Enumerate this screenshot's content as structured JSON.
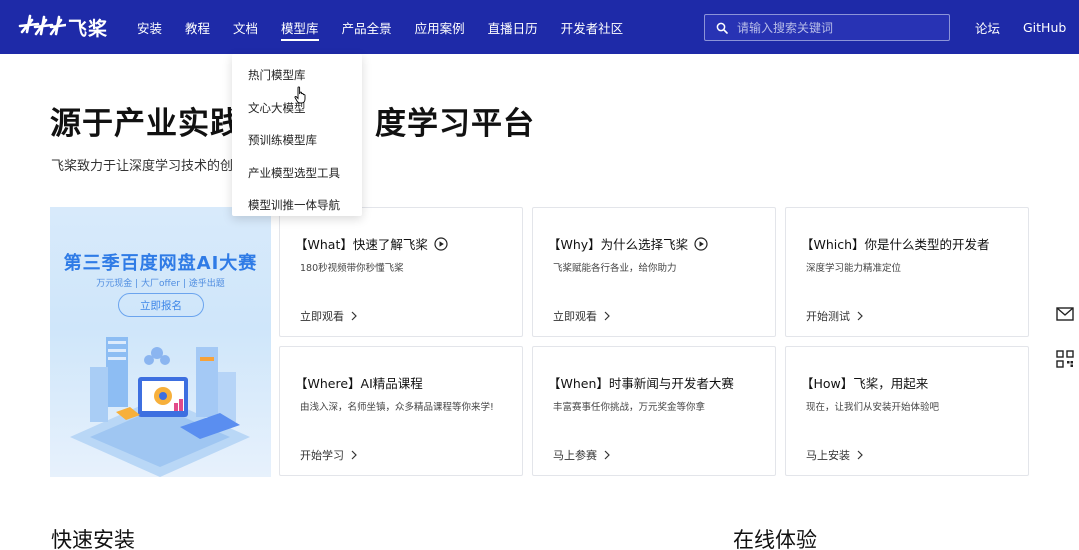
{
  "brand": {
    "name": "飞桨"
  },
  "nav": {
    "items": [
      {
        "label": "安装"
      },
      {
        "label": "教程"
      },
      {
        "label": "文档"
      },
      {
        "label": "模型库"
      },
      {
        "label": "产品全景"
      },
      {
        "label": "应用案例"
      },
      {
        "label": "直播日历"
      },
      {
        "label": "开发者社区"
      }
    ],
    "active_label": "模型库"
  },
  "search": {
    "placeholder": "请输入搜索关键词",
    "value": ""
  },
  "top_links": {
    "forum": "论坛",
    "github": "GitHub"
  },
  "dropdown": {
    "items": [
      {
        "label": "热门模型库"
      },
      {
        "label": "文心大模型"
      },
      {
        "label": "预训练模型库"
      },
      {
        "label": "产业模型选型工具"
      },
      {
        "label": "模型训推一体导航"
      }
    ]
  },
  "hero": {
    "title_left": "源于产业实践",
    "title_right": "度学习平台",
    "subtitle": "飞桨致力于让深度学习技术的创"
  },
  "banner": {
    "title": "第三季百度网盘AI大赛",
    "tags": "万元现金 | 大厂offer | 途乎出题",
    "button": "立即报名"
  },
  "cards": [
    {
      "title": "【What】快速了解飞桨",
      "desc": "180秒视频带你秒懂飞桨",
      "link": "立即观看",
      "has_play": true
    },
    {
      "title": "【Why】为什么选择飞桨",
      "desc": "飞桨赋能各行各业，给你助力",
      "link": "立即观看",
      "has_play": true
    },
    {
      "title": "【Which】你是什么类型的开发者",
      "desc": "深度学习能力精准定位",
      "link": "开始测试",
      "has_play": false
    },
    {
      "title": "【Where】AI精品课程",
      "desc": "由浅入深，名师坐镇，众多精品课程等你来学!",
      "link": "开始学习",
      "has_play": false
    },
    {
      "title": "【When】时事新闻与开发者大赛",
      "desc": "丰富赛事任你挑战，万元奖金等你拿",
      "link": "马上参赛",
      "has_play": false
    },
    {
      "title": "【How】飞桨，用起来",
      "desc": "现在，让我们从安装开始体验吧",
      "link": "马上安装",
      "has_play": false
    }
  ],
  "sections": {
    "quick_install": "快速安装",
    "online_try": "在线体验"
  },
  "colors": {
    "nav_bg": "#1e2aa8",
    "accent": "#2932e1",
    "banner_accent": "#2f7be6"
  },
  "icons": {
    "mail": "mail-icon",
    "qr": "qr-code-icon",
    "play": "play-circle-icon",
    "chevron": "chevron-right-icon"
  }
}
